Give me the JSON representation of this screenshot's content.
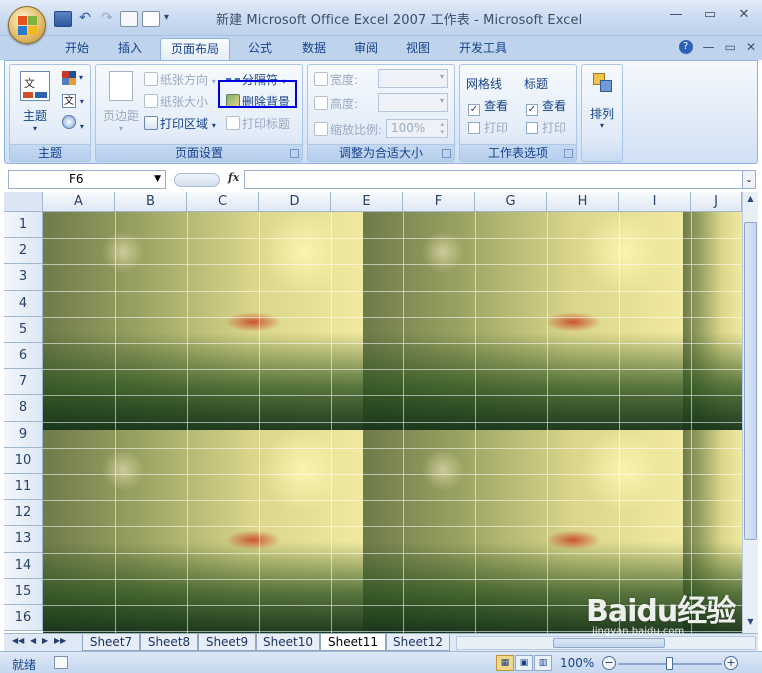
{
  "window": {
    "title": "新建 Microsoft Office Excel 2007 工作表 - Microsoft Excel"
  },
  "ribbon_tabs": [
    "开始",
    "插入",
    "页面布局",
    "公式",
    "数据",
    "审阅",
    "视图",
    "开发工具"
  ],
  "active_tab": "页面布局",
  "ribbon": {
    "theme_group": {
      "label": "主题",
      "themes_button": "主题"
    },
    "page_setup_group": {
      "label": "页面设置",
      "margins": "页边距",
      "orientation": "纸张方向",
      "size": "纸张大小",
      "print_area": "打印区域",
      "breaks": "分隔符",
      "delete_background": "删除背景",
      "print_titles": "打印标题"
    },
    "scale_group": {
      "label": "调整为合适大小",
      "width_label": "宽度:",
      "height_label": "高度:",
      "scale_label": "缩放比例:",
      "scale_value": "100%"
    },
    "sheet_options_group": {
      "label": "工作表选项",
      "gridlines_heading": "网格线",
      "headings_heading": "标题",
      "gridlines_view": "查看",
      "gridlines_print": "打印",
      "headings_view": "查看",
      "headings_print": "打印",
      "gridlines_view_checked": true,
      "gridlines_print_checked": false,
      "headings_view_checked": true,
      "headings_print_checked": false
    },
    "arrange_group": {
      "label": "排列"
    }
  },
  "formula_bar": {
    "name_box": "F6",
    "fx_label": "fx",
    "formula_value": ""
  },
  "grid": {
    "columns": [
      "A",
      "B",
      "C",
      "D",
      "E",
      "F",
      "G",
      "H",
      "I",
      "J"
    ],
    "rows": [
      "1",
      "2",
      "3",
      "4",
      "5",
      "6",
      "7",
      "8",
      "9",
      "10",
      "11",
      "12",
      "13",
      "14",
      "15",
      "16"
    ],
    "background_image": "green-meadow-ant-photo"
  },
  "sheet_tabs": [
    "Sheet7",
    "Sheet8",
    "Sheet9",
    "Sheet10",
    "Sheet11",
    "Sheet12"
  ],
  "active_sheet": "Sheet11",
  "status_bar": {
    "status": "就绪",
    "zoom": "100%"
  },
  "watermark": {
    "brand": "Baidu经验",
    "url": "jingyan.baidu.com"
  }
}
